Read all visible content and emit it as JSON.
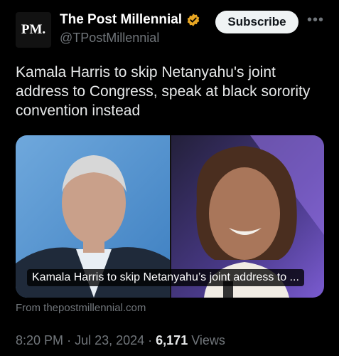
{
  "account": {
    "avatar_text": "PM.",
    "display_name": "The Post Millennial",
    "handle": "@TPostMillennial",
    "subscribe_label": "Subscribe",
    "verified_icon": "verified-gold-badge-icon",
    "more_icon": "more-icon"
  },
  "post": {
    "text": "Kamala Harris to skip Netanyahu's joint address to Congress, speak at black sorority convention instead"
  },
  "card": {
    "caption": "Kamala Harris to skip Netanyahu’s joint address to ...",
    "source": "From thepostmillennial.com"
  },
  "meta": {
    "time": "8:20 PM",
    "date": "Jul 23, 2024",
    "views_count": "6,171",
    "views_label": "Views"
  },
  "colors": {
    "background": "#000000",
    "text": "#e7e9ea",
    "muted": "#71767b",
    "badge": "#e8a623"
  }
}
